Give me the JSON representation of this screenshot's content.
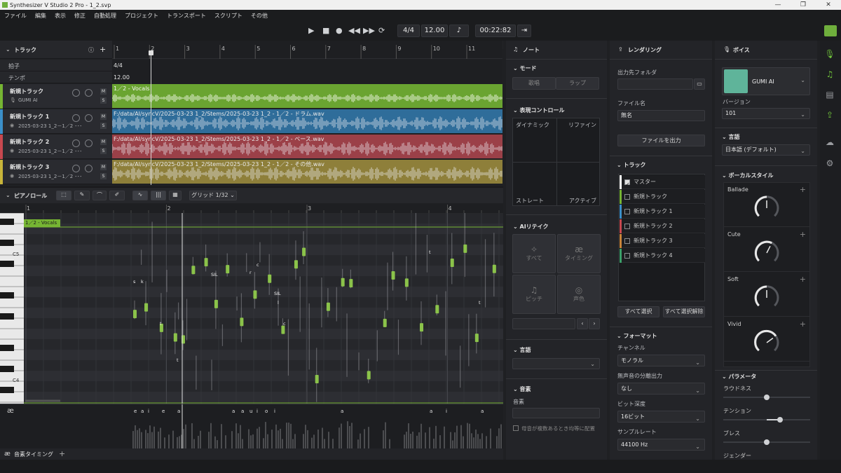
{
  "titlebar": {
    "title": "Synthesizer V Studio 2 Pro - 1_2.svp",
    "buttons": [
      "—",
      "❐",
      "✕"
    ]
  },
  "menu": [
    "ファイル",
    "編集",
    "表示",
    "修正",
    "自動処理",
    "プロジェクト",
    "トランスポート",
    "スクリプト",
    "その他"
  ],
  "transport": {
    "time_sig": "4/4",
    "tempo": "12.00",
    "time": "00:22:82"
  },
  "tracks_panel": {
    "title": "トラック",
    "meta": [
      {
        "label": "拍子",
        "value": "4/4"
      },
      {
        "label": "テンポ",
        "value": "12.00"
      }
    ],
    "tracks": [
      {
        "name": "新規トラック",
        "sub": "GUMI AI",
        "color": "#76b533",
        "clip": "1／2 - Vocals",
        "clip_bg": "#6aa431"
      },
      {
        "name": "新規トラック 1",
        "sub": "2025-03-23 1_2－1／2 ･･･",
        "color": "#3b8fc9",
        "clip": "F:/data/AI/syncV/2025-03-23 1_2/Stems/2025-03-23 1_2 - 1／2 - ドラム.wav",
        "clip_bg": "#2f6d9a"
      },
      {
        "name": "新規トラック 2",
        "sub": "2025-03-23 1_2－1／2 ･･･",
        "color": "#c8484f",
        "clip": "F:/data/AI/syncV/2025-03-23 1_2/Stems/2025-03-23 1_2 - 1／2 - ベース.wav",
        "clip_bg": "#9b4048"
      },
      {
        "name": "新規トラック 3",
        "sub": "2025-03-23 1_2－1／2 ･･･",
        "color": "#c8b43a",
        "clip": "F:/data/AI/syncV/2025-03-23 1_2/Stems/2025-03-23 1_2 - 1／2 - その他.wav",
        "clip_bg": "#8e7f3a"
      }
    ],
    "ruler": [
      "1",
      "2",
      "3",
      "4",
      "5",
      "6",
      "7",
      "8",
      "9",
      "10",
      "11"
    ]
  },
  "piano_roll": {
    "title": "ピアノロール",
    "grid": "グリッド 1/32",
    "ruler": [
      "1",
      "2",
      "3",
      "4"
    ],
    "clip_label": "1／2 - Vocals",
    "keys": [
      "C5",
      "C4"
    ],
    "lyrics": [
      "s",
      "k",
      "t",
      "t",
      "SIL",
      "r",
      "c",
      "SIL",
      "l",
      "c",
      "t",
      "t"
    ],
    "phonemes": [
      "e",
      "a",
      "i",
      "e",
      "a",
      "a",
      "a",
      "u",
      "i",
      "o",
      "i",
      "a",
      "a",
      "i",
      "a"
    ],
    "phoneme_symbol": "æ"
  },
  "bottom": {
    "tab": "音素タイミング",
    "symbol": "æ"
  },
  "note_panel": {
    "title": "ノート",
    "mode_title": "モード",
    "modes": [
      "歌唱",
      "ラップ"
    ],
    "expr_title": "表現コントロール",
    "expr": [
      "ダイナミック",
      "リファイン",
      "ストレート",
      "アクティブ"
    ],
    "retake_title": "AIリテイク",
    "retake": [
      "すべて",
      "タイミング",
      "ピッチ",
      "声色"
    ],
    "lang_title": "言語",
    "phoneme_title": "音素",
    "phoneme_label": "音素",
    "checkbox": "母音が複数あるとき均等に配置"
  },
  "render_panel": {
    "title": "レンダリング",
    "out_folder": "出力先フォルダ",
    "file_name_label": "ファイル名",
    "file_name": "無名",
    "export": "ファイルを出力",
    "tracks_title": "トラック",
    "tracks": [
      {
        "name": "マスター",
        "color": "#ffffff",
        "checked": true
      },
      {
        "name": "新規トラック",
        "color": "#76b533"
      },
      {
        "name": "新規トラック 1",
        "color": "#3b8fc9"
      },
      {
        "name": "新規トラック 2",
        "color": "#c8484f"
      },
      {
        "name": "新規トラック 3",
        "color": "#c8843a"
      },
      {
        "name": "新規トラック 4",
        "color": "#3ba06a"
      }
    ],
    "select_all": "すべて選択",
    "deselect_all": "すべて選択解除",
    "format_title": "フォーマット",
    "fields": [
      {
        "label": "チャンネル",
        "value": "モノラル"
      },
      {
        "label": "無声音の分離出力",
        "value": "なし"
      },
      {
        "label": "ビット深度",
        "value": "16ビット"
      },
      {
        "label": "サンプルレート",
        "value": "44100 Hz"
      }
    ]
  },
  "voice_panel": {
    "title": "ボイス",
    "voice": "GUMI AI",
    "version_label": "バージョン",
    "version": "101",
    "lang_title": "言語",
    "lang": "日本語 (デフォルト)",
    "style_title": "ボーカルスタイル",
    "styles": [
      {
        "name": "Ballade",
        "level": 0.5
      },
      {
        "name": "Cute",
        "level": 0.6
      },
      {
        "name": "Soft",
        "level": 0.5
      },
      {
        "name": "Vivid",
        "level": 0.7
      }
    ],
    "params_title": "パラメータ",
    "params": [
      {
        "name": "ラウドネス",
        "value": 0.5
      },
      {
        "name": "テンション",
        "value": 0.65
      },
      {
        "name": "ブレス",
        "value": 0.5
      },
      {
        "name": "ジェンダー",
        "value": 0.5
      }
    ]
  }
}
